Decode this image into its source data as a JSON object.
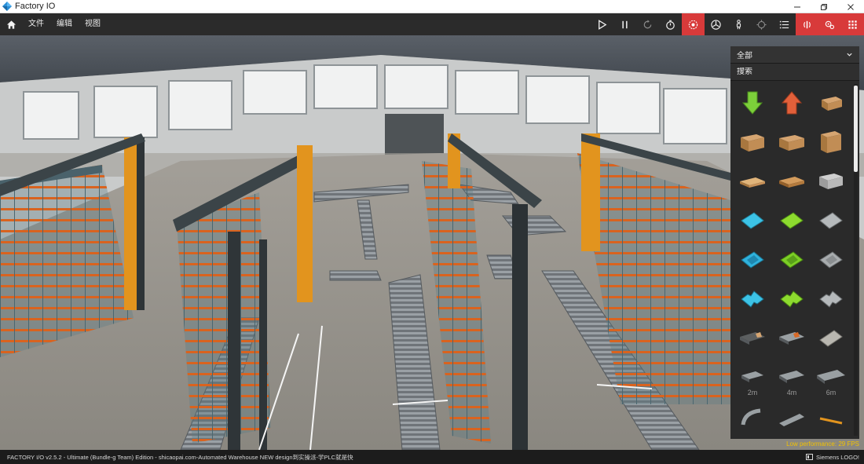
{
  "window": {
    "title": "Factory IO",
    "controls": [
      "minimize-icon",
      "restore-icon",
      "close-icon"
    ]
  },
  "menu": {
    "items": [
      {
        "label": "文件"
      },
      {
        "label": "编辑"
      },
      {
        "label": "视图"
      }
    ]
  },
  "toolbar": {
    "buttons": [
      {
        "icon": "play-icon"
      },
      {
        "icon": "pause-icon"
      },
      {
        "icon": "reset-icon"
      },
      {
        "icon": "stopwatch-icon"
      },
      {
        "icon": "camera-orbit-icon",
        "active": true
      },
      {
        "icon": "fan-icon"
      },
      {
        "icon": "first-person-icon"
      },
      {
        "icon": "crosshair-icon"
      },
      {
        "icon": "list-icon"
      },
      {
        "icon": "sensors-icon",
        "active": true
      },
      {
        "icon": "drivers-icon",
        "active": true
      },
      {
        "icon": "grid-icon",
        "active": true
      }
    ],
    "active_color": "#d83a3a"
  },
  "palette": {
    "category": "全部",
    "search_placeholder": "搜索",
    "items": [
      {
        "icon": "emitter-icon"
      },
      {
        "icon": "remover-icon"
      },
      {
        "icon": "small-box-icon"
      },
      {
        "icon": "medium-box-icon"
      },
      {
        "icon": "large-box-icon"
      },
      {
        "icon": "tall-box-icon"
      },
      {
        "icon": "pallet-icon"
      },
      {
        "icon": "wood-pallet-icon"
      },
      {
        "icon": "pallet-bin-icon"
      },
      {
        "icon": "blue-raw-material-icon"
      },
      {
        "icon": "green-raw-material-icon"
      },
      {
        "icon": "metal-raw-material-icon"
      },
      {
        "icon": "blue-product-base-icon"
      },
      {
        "icon": "green-product-base-icon"
      },
      {
        "icon": "metal-product-base-icon"
      },
      {
        "icon": "blue-product-lid-icon"
      },
      {
        "icon": "green-product-lid-icon"
      },
      {
        "icon": "metal-product-lid-icon"
      },
      {
        "icon": "roller-conveyor-icon"
      },
      {
        "icon": "belt-conveyor-icon"
      },
      {
        "icon": "stacking-plate-icon"
      },
      {
        "icon": "conveyor-2m-icon",
        "label": "2m"
      },
      {
        "icon": "conveyor-4m-icon",
        "label": "4m"
      },
      {
        "icon": "conveyor-6m-icon",
        "label": "6m"
      },
      {
        "icon": "curved-conveyor-icon"
      },
      {
        "icon": "ramp-conveyor-icon"
      },
      {
        "icon": "rod-icon"
      }
    ]
  },
  "status": {
    "info": "FACTORY I/O v2.5.2 - Ultimate (Bundle-g Team) Edition - shicaopai.com-Automated Warehouse NEW design到实操派-学PLC就是快",
    "performance": "Low performance: 29 FPS",
    "driver": "Siemens LOGO!"
  }
}
